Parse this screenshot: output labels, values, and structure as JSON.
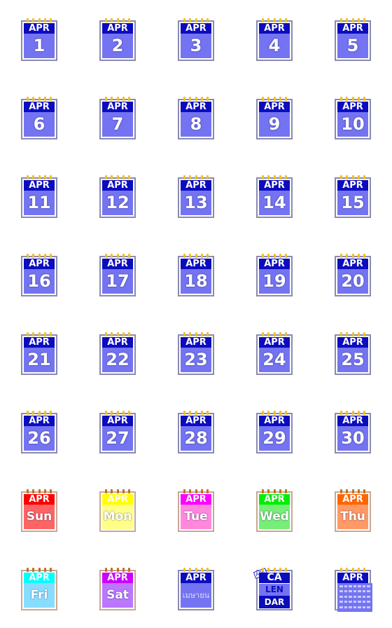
{
  "month": "APR",
  "dates": [
    "1",
    "2",
    "3",
    "4",
    "5",
    "6",
    "7",
    "8",
    "9",
    "10",
    "11",
    "12",
    "13",
    "14",
    "15",
    "16",
    "17",
    "18",
    "19",
    "20",
    "21",
    "22",
    "23",
    "24",
    "25",
    "26",
    "27",
    "28",
    "29",
    "30"
  ],
  "default_colors": {
    "header": "#0c0cbf",
    "body": "#7474f2"
  },
  "weekdays": [
    {
      "label": "Sun",
      "header": "#ff0000",
      "body": "#ff6464"
    },
    {
      "label": "Mon",
      "header": "#ffff00",
      "body": "#ffff88"
    },
    {
      "label": "Tue",
      "header": "#ff00ff",
      "body": "#ff88dd"
    },
    {
      "label": "Wed",
      "header": "#00ee00",
      "body": "#77ee77"
    },
    {
      "label": "Thu",
      "header": "#ff6600",
      "body": "#ff9966"
    },
    {
      "label": "Fri",
      "header": "#00ffff",
      "body": "#88ddff"
    },
    {
      "label": "Sat",
      "header": "#cc00ff",
      "body": "#bb77ff"
    }
  ],
  "thai_month": "เมษายน",
  "calendar_word": [
    "CA",
    "LEN",
    "DAR"
  ],
  "calendar_tag": "APR"
}
